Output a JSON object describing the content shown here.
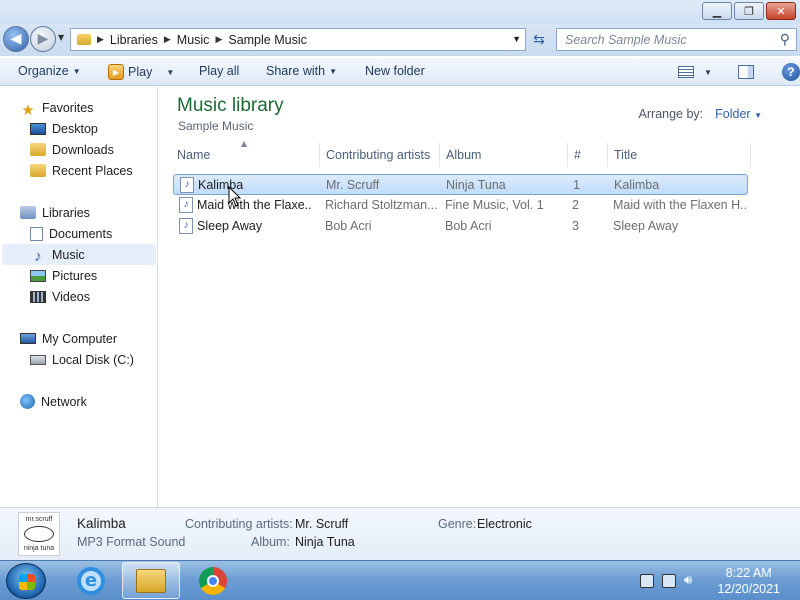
{
  "window": {
    "min_label": "▭",
    "max_label": "❐",
    "close_label": "✕"
  },
  "address": {
    "crumbs": [
      "Libraries",
      "Music",
      "Sample Music"
    ],
    "search_placeholder": "Search Sample Music"
  },
  "toolbar": {
    "organize": "Organize",
    "play": "Play",
    "play_all": "Play all",
    "share_with": "Share with",
    "new_folder": "New folder"
  },
  "nav": {
    "favorites": "Favorites",
    "desktop": "Desktop",
    "downloads": "Downloads",
    "recent_places": "Recent Places",
    "libraries": "Libraries",
    "documents": "Documents",
    "music": "Music",
    "pictures": "Pictures",
    "videos": "Videos",
    "my_computer": "My Computer",
    "local_disk": "Local Disk (C:)",
    "network": "Network"
  },
  "library": {
    "title": "Music library",
    "subtitle": "Sample Music",
    "arrange_label": "Arrange by:",
    "arrange_value": "Folder"
  },
  "columns": [
    "Name",
    "Contributing artists",
    "Album",
    "#",
    "Title"
  ],
  "rows": [
    {
      "name": "Kalimba",
      "artist": "Mr. Scruff",
      "album": "Ninja Tuna",
      "num": "1",
      "title": "Kalimba",
      "selected": true
    },
    {
      "name": "Maid with the Flaxe...",
      "artist": "Richard Stoltzman...",
      "album": "Fine Music, Vol. 1",
      "num": "2",
      "title": "Maid with the Flaxen H...",
      "selected": false
    },
    {
      "name": "Sleep Away",
      "artist": "Bob Acri",
      "album": "Bob Acri",
      "num": "3",
      "title": "Sleep Away",
      "selected": false
    }
  ],
  "details": {
    "name": "Kalimba",
    "type": "MP3 Format Sound",
    "artists_label": "Contributing artists:",
    "artists_value": "Mr. Scruff",
    "album_label": "Album:",
    "album_value": "Ninja Tuna",
    "genre_label": "Genre:",
    "genre_value": "Electronic",
    "thumb_top": "mr.scruff",
    "thumb_bottom": "ninja tuna"
  },
  "taskbar": {
    "time": "8:22 AM",
    "date": "12/20/2021"
  },
  "colors": {
    "title_green": "#1e6b33",
    "link_blue": "#2c62a8",
    "selection": "#c1dcfc"
  }
}
